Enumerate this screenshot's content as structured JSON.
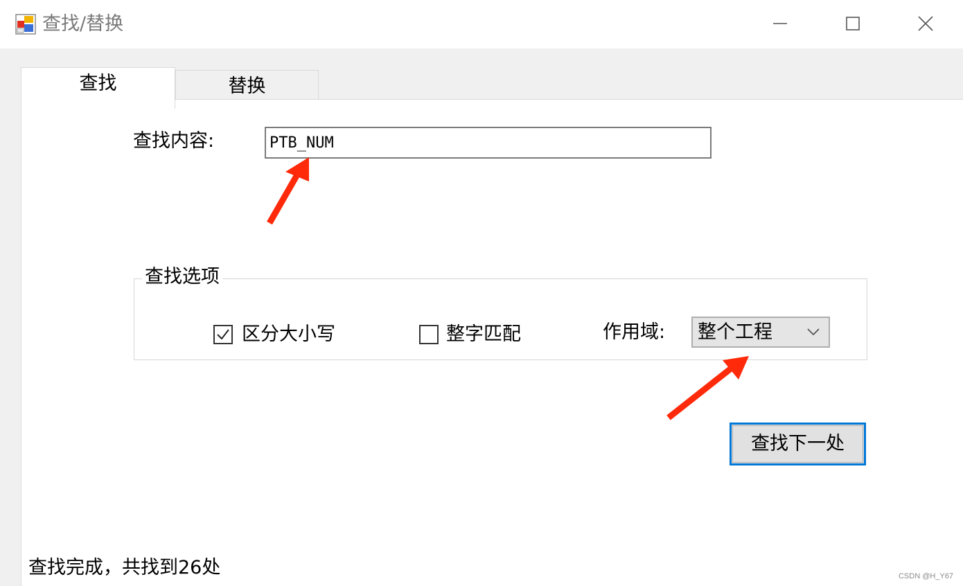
{
  "window": {
    "title": "查找/替换",
    "controls": [
      "minimize-icon",
      "maximize-icon",
      "close-icon"
    ]
  },
  "tabs": [
    {
      "label": "查找",
      "active": true
    },
    {
      "label": "替换",
      "active": false
    }
  ],
  "find": {
    "label": "查找内容:",
    "value": "PTB_NUM"
  },
  "options": {
    "title": "查找选项",
    "match_case": {
      "label": "区分大小写",
      "checked": true
    },
    "whole_word": {
      "label": "整字匹配",
      "checked": false
    },
    "scope": {
      "label": "作用域:",
      "selected": "整个工程"
    }
  },
  "buttons": {
    "find_next": "查找下一处"
  },
  "status": "查找完成，共找到26处",
  "watermark": "CSDN @H_Y67",
  "colors": {
    "annotation_arrow": "#ff2a0a",
    "focus_border": "#0078d7"
  }
}
